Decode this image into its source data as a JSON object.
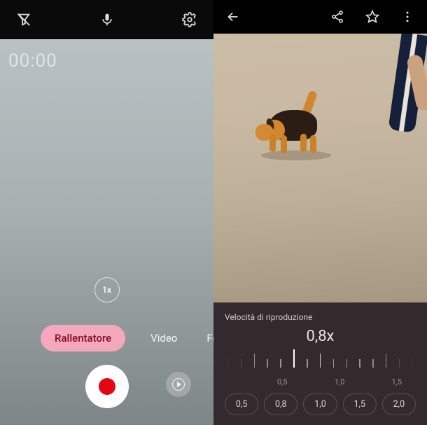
{
  "camera": {
    "timer": "00:00",
    "zoom": "1x",
    "modes": {
      "slowmo": "Rallentatore",
      "video": "Video",
      "photo": "Foto"
    }
  },
  "player": {
    "panel_title": "Velocità di riproduzione",
    "current_speed": "0,8x",
    "ruler_labels": {
      "low": "0,5",
      "mid": "1,0",
      "high": "1,5"
    },
    "presets": [
      "0,5",
      "0,8",
      "1,0",
      "1,5",
      "2,0"
    ]
  }
}
